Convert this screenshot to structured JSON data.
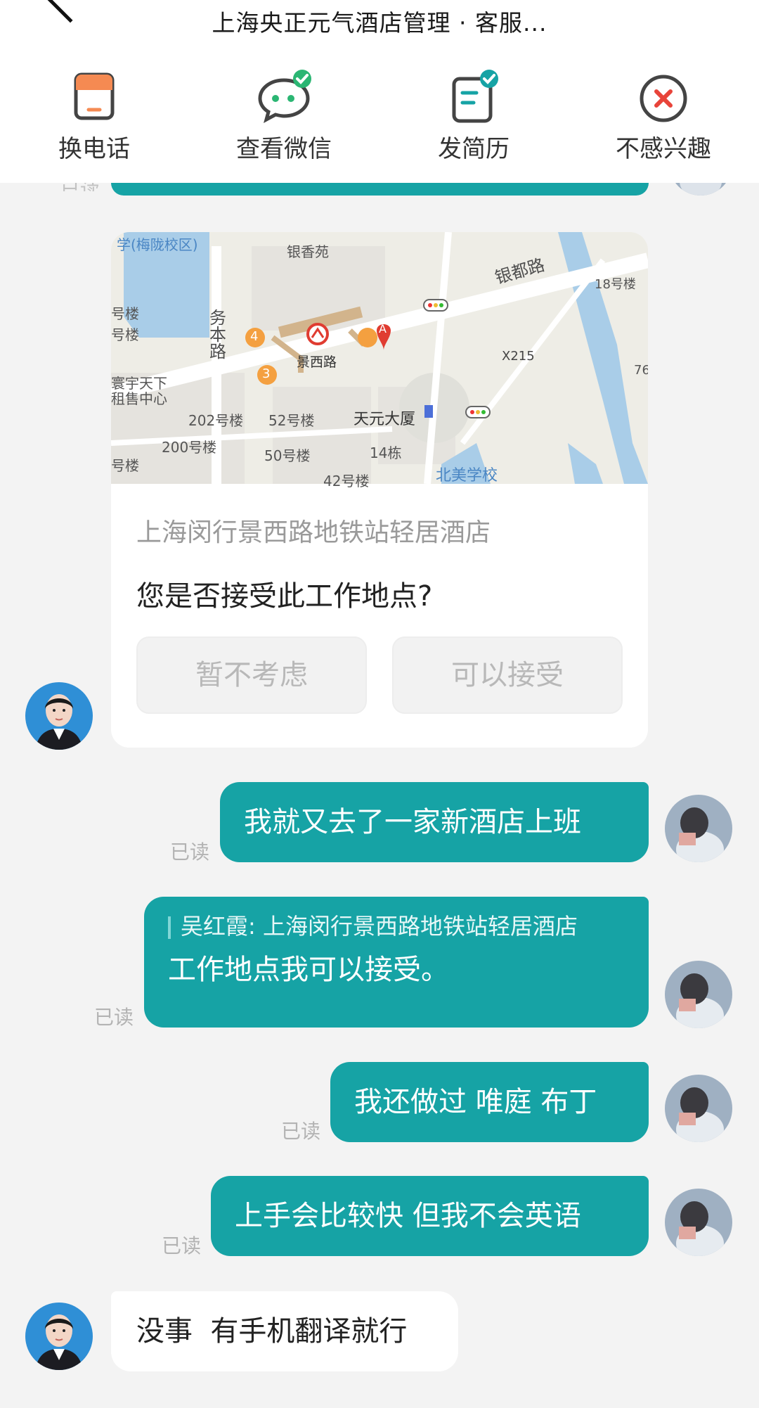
{
  "header": {
    "title": "上海央正元气酒店管理 · 客服...",
    "actions": [
      {
        "label": "换电话",
        "icon": "phone-card-icon"
      },
      {
        "label": "查看微信",
        "icon": "wechat-bubble-icon"
      },
      {
        "label": "发简历",
        "icon": "resume-icon"
      },
      {
        "label": "不感兴趣",
        "icon": "not-interested-icon"
      }
    ]
  },
  "chat": {
    "read_label": "已读",
    "location_card": {
      "map_labels": {
        "school": "学(梅陇校区)",
        "yinxiangyuan": "银香苑",
        "yindu_road": "银都路",
        "building18": "18号楼",
        "wuben_road": "务本路",
        "station": "景西路",
        "x215": "X215",
        "rent_center": "寰宇天下\n租售中心",
        "b202": "202号楼",
        "b52": "52号楼",
        "tianyuan": "天元大厦",
        "b200": "200号楼",
        "b50": "50号楼",
        "b14": "14栋",
        "b42": "42号楼",
        "beimei": "北美学校",
        "lou": "号楼",
        "num76": "76",
        "marker_a": "A",
        "exit3": "3",
        "exit4": "4"
      },
      "place": "上海闵行景西路地铁站轻居酒店",
      "question": "您是否接受此工作地点?",
      "decline_button": "暂不考虑",
      "accept_button": "可以接受"
    },
    "messages": [
      {
        "side": "out",
        "text": "我就又去了一家新酒店上班"
      },
      {
        "side": "out",
        "quote": "吴红霞: 上海闵行景西路地铁站轻居酒店",
        "text": "工作地点我可以接受。"
      },
      {
        "side": "out",
        "text": "我还做过 唯庭 布丁"
      },
      {
        "side": "out",
        "text": "上手会比较快 但我不会英语"
      },
      {
        "side": "in",
        "text": "没事  有手机翻译就行"
      }
    ]
  },
  "colors": {
    "bubble_out": "#16a3a5",
    "accent_check": "#2bb673",
    "reject_red": "#e8443a"
  }
}
